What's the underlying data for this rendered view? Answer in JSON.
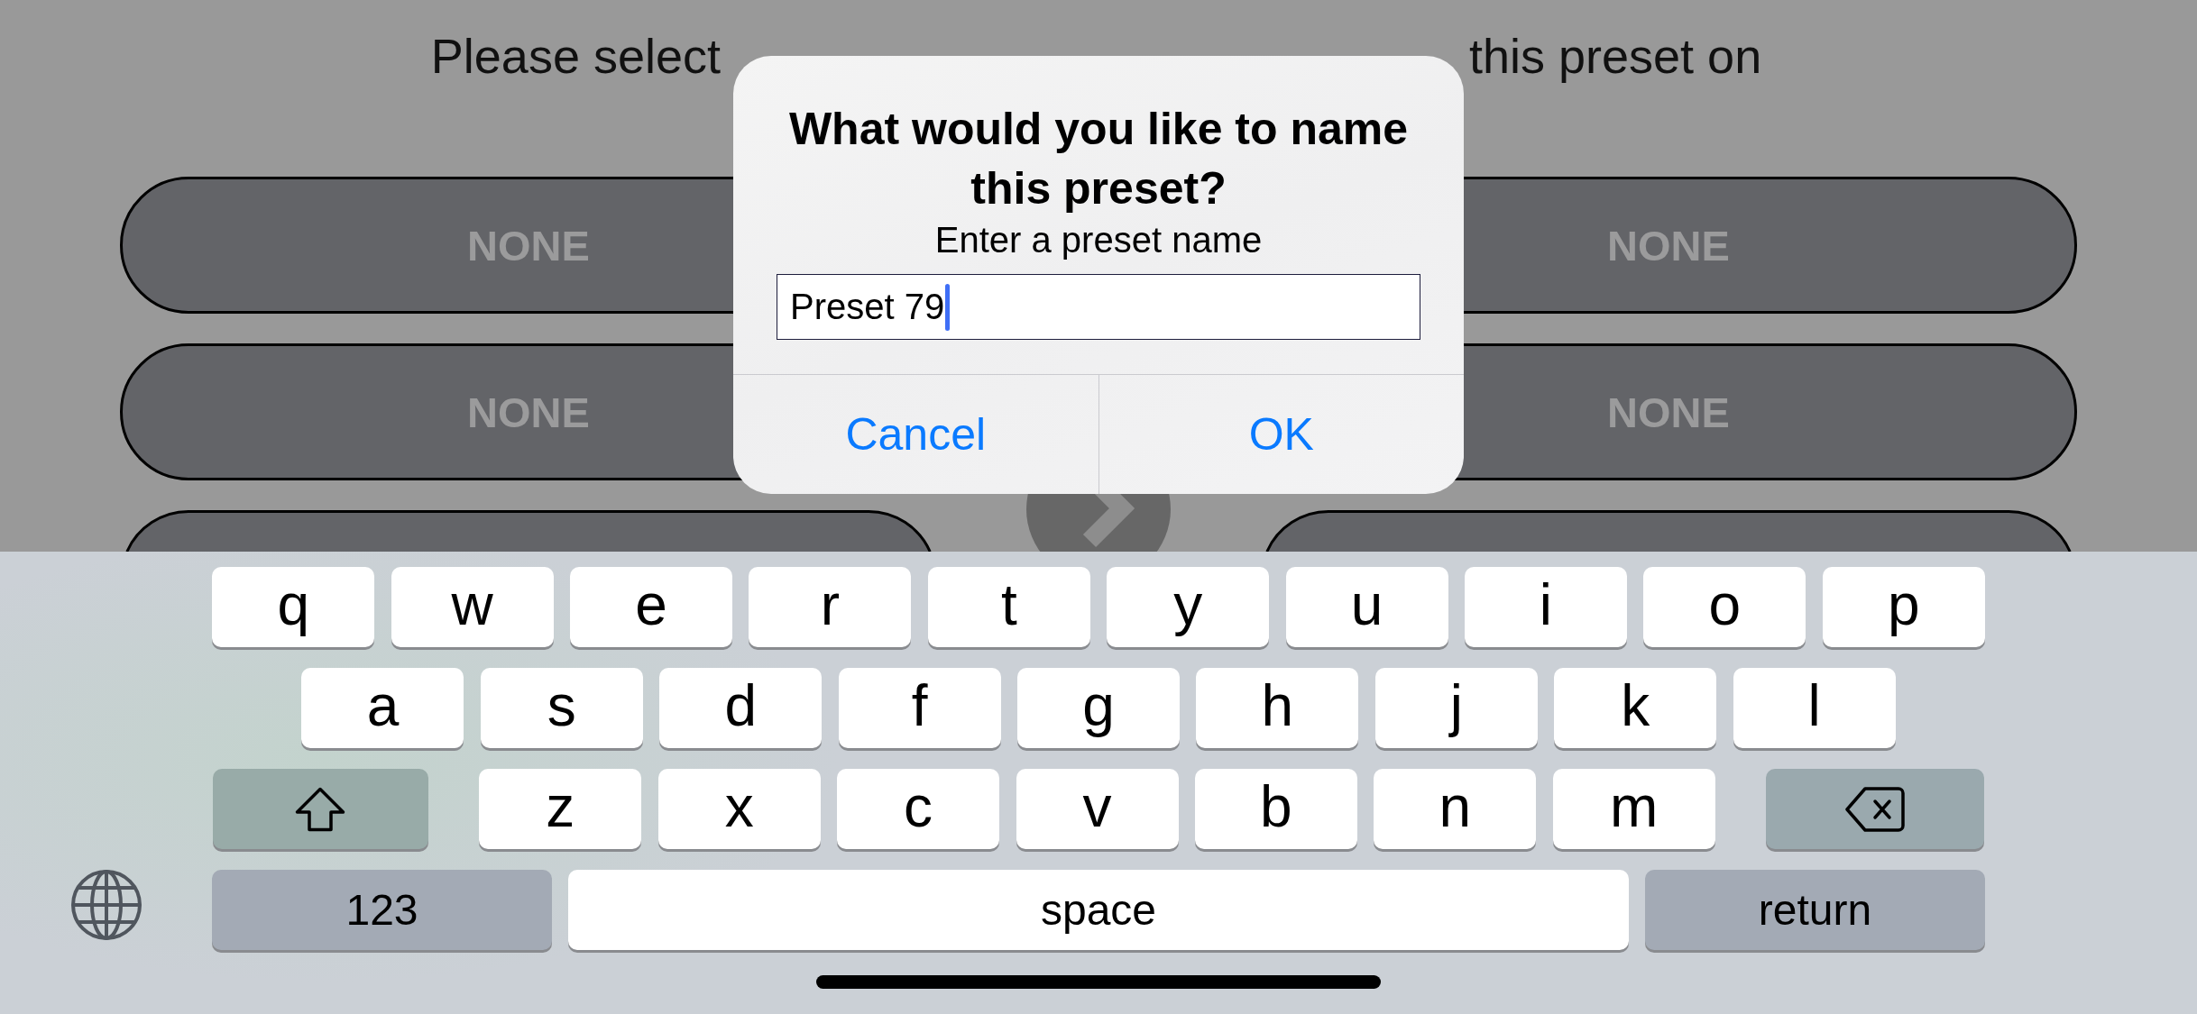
{
  "screen": {
    "instruction": [
      "Please select",
      "this preset on"
    ]
  },
  "preset_buttons": [
    {
      "kind": "full",
      "label": "NONE"
    },
    {
      "kind": "full",
      "label": "NONE"
    },
    {
      "kind": "full",
      "label": "NONE"
    },
    {
      "kind": "full",
      "label": "NONE"
    },
    {
      "kind": "cut"
    },
    {
      "kind": "cut"
    }
  ],
  "dialog": {
    "title": "What would you like to name this preset?",
    "message": "Enter a preset name",
    "field": {
      "value": "Preset 79",
      "focused": true
    },
    "buttons": [
      {
        "label": "Cancel"
      },
      {
        "label": "OK"
      }
    ]
  },
  "keyboard": {
    "rows": [
      {
        "keys": [
          {
            "kind": "letter",
            "label": "q"
          },
          {
            "kind": "letter",
            "label": "w"
          },
          {
            "kind": "letter",
            "label": "e"
          },
          {
            "kind": "letter",
            "label": "r"
          },
          {
            "kind": "letter",
            "label": "t"
          },
          {
            "kind": "letter",
            "label": "y"
          },
          {
            "kind": "letter",
            "label": "u"
          },
          {
            "kind": "letter",
            "label": "i"
          },
          {
            "kind": "letter",
            "label": "o"
          },
          {
            "kind": "letter",
            "label": "p"
          }
        ]
      },
      {
        "keys": [
          {
            "kind": "letter",
            "label": "a"
          },
          {
            "kind": "letter",
            "label": "s"
          },
          {
            "kind": "letter",
            "label": "d"
          },
          {
            "kind": "letter",
            "label": "f"
          },
          {
            "kind": "letter",
            "label": "g"
          },
          {
            "kind": "letter",
            "label": "h"
          },
          {
            "kind": "letter",
            "label": "j"
          },
          {
            "kind": "letter",
            "label": "k"
          },
          {
            "kind": "letter",
            "label": "l"
          }
        ]
      },
      {
        "keys": [
          {
            "kind": "shift",
            "on": false
          },
          {
            "kind": "letter",
            "label": "z"
          },
          {
            "kind": "letter",
            "label": "x"
          },
          {
            "kind": "letter",
            "label": "c"
          },
          {
            "kind": "letter",
            "label": "v"
          },
          {
            "kind": "letter",
            "label": "b"
          },
          {
            "kind": "letter",
            "label": "n"
          },
          {
            "kind": "letter",
            "label": "m"
          },
          {
            "kind": "delete"
          }
        ]
      },
      {
        "keys": [
          {
            "kind": "numbers",
            "label": "123"
          },
          {
            "kind": "space",
            "label": "space"
          },
          {
            "kind": "return",
            "label": "return"
          }
        ]
      }
    ]
  }
}
